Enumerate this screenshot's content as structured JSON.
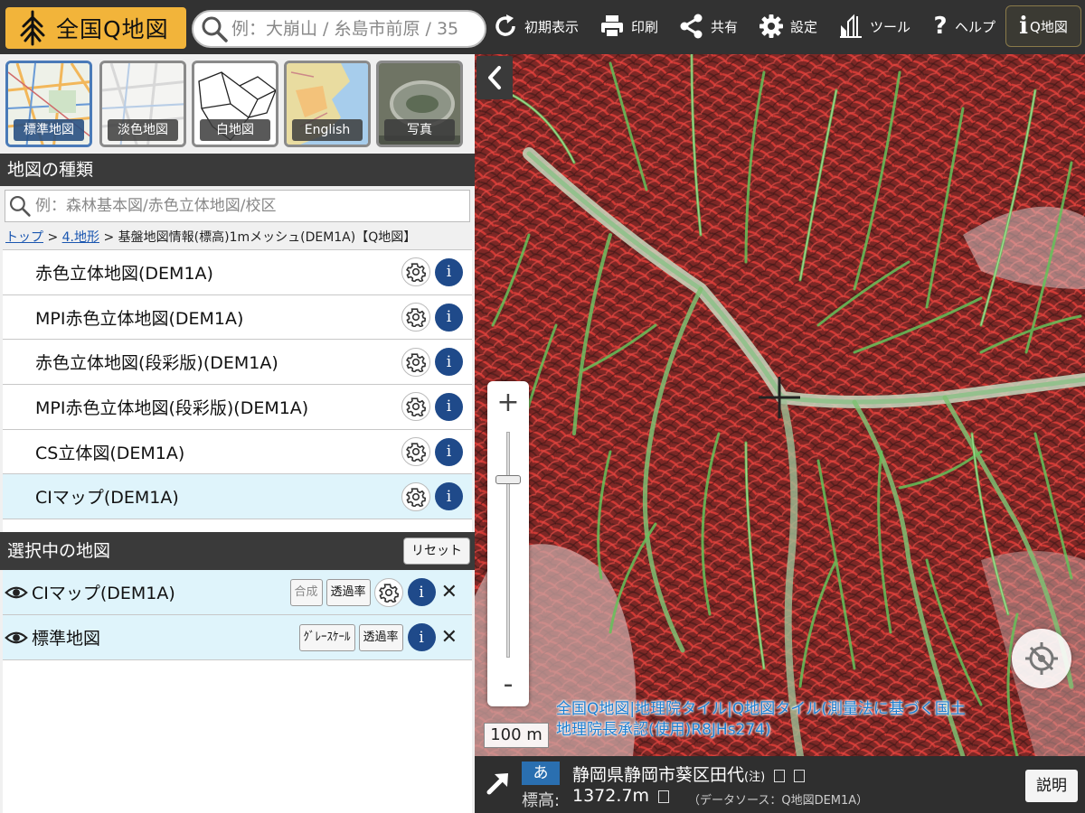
{
  "header": {
    "logo_text": "全国Q地図",
    "search_placeholder": "例：大崩山 / 糸島市前原 / 35",
    "buttons": [
      {
        "label": "初期表示",
        "icon": "reset-icon"
      },
      {
        "label": "印刷",
        "icon": "printer-icon"
      },
      {
        "label": "共有",
        "icon": "share-icon"
      },
      {
        "label": "設定",
        "icon": "gear-icon"
      },
      {
        "label": "ツール",
        "icon": "tools-icon"
      },
      {
        "label": "ヘルプ",
        "icon": "help-icon"
      }
    ],
    "qmap_label": "Q地図",
    "colors": {
      "bar": "#323232",
      "logo": "#f2b43a"
    }
  },
  "basemaps": [
    {
      "label": "標準地図",
      "active": true
    },
    {
      "label": "淡色地図",
      "active": false
    },
    {
      "label": "白地図",
      "active": false
    },
    {
      "label": "English",
      "active": false
    },
    {
      "label": "写真",
      "active": false
    }
  ],
  "layers_panel": {
    "title": "地図の種類",
    "search_placeholder": "例：森林基本図/赤色立体地図/校区",
    "breadcrumb": {
      "top": "トップ",
      "sep1": ">",
      "category": "4.地形",
      "sep2": ">",
      "current": "基盤地図情報(標高)1mメッシュ(DEM1A)【Q地図】"
    },
    "items": [
      {
        "name": "赤色立体地図(DEM1A)",
        "selected": false
      },
      {
        "name": "MPI赤色立体地図(DEM1A)",
        "selected": false
      },
      {
        "name": "赤色立体地図(段彩版)(DEM1A)",
        "selected": false
      },
      {
        "name": "MPI赤色立体地図(段彩版)(DEM1A)",
        "selected": false
      },
      {
        "name": "CS立体図(DEM1A)",
        "selected": false
      },
      {
        "name": "CIマップ(DEM1A)",
        "selected": true
      }
    ],
    "info_glyph": "i"
  },
  "selected_panel": {
    "title": "選択中の地図",
    "reset_label": "リセット",
    "items": [
      {
        "name": "CIマップ(DEM1A)",
        "btn1": "合成",
        "btn2": "透過率"
      },
      {
        "name": "標準地図",
        "btn1": "ｸﾞﾚｰｽｹｰﾙ",
        "btn2": "透過率"
      }
    ],
    "close_glyph": "✕"
  },
  "map": {
    "zoom_in": "+",
    "zoom_out": "-",
    "zoom_level_fraction": 0.2,
    "scale_label": "100 m",
    "attribution_line1": "全国Q地図|地理院タイル|Q地図タイル(測量法に基づく国土",
    "attribution_line2": "地理院長承認(使用)R8JHs274)"
  },
  "status": {
    "kana": "あ",
    "place": "静岡県静岡市葵区田代",
    "place_note": "(注)",
    "elev_label": "標高:",
    "elev_value": "1372.7m",
    "elev_source": "（データソース：Q地図DEM1A）",
    "help_label": "説明"
  }
}
